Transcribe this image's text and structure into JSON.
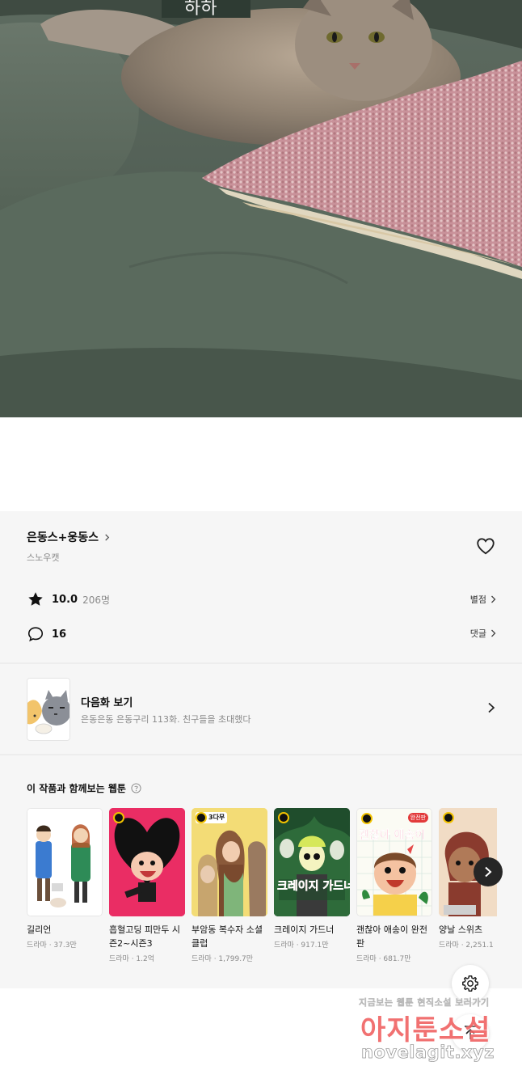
{
  "hero": {
    "overlay_text": "하하"
  },
  "work": {
    "title": "은동스+웅동스",
    "author": "스노우캣",
    "rating": "10.0",
    "rating_count": "206명",
    "rate_label": "별점",
    "comment_count": "16",
    "comment_label": "댓글"
  },
  "next_episode": {
    "title": "다음화 보기",
    "description": "은동은동 은동구리 113화. 친구들을 초대했다"
  },
  "recommendations": {
    "heading": "이 작품과 함께보는 웹툰",
    "items": [
      {
        "name": "길리언",
        "meta": "드라마 · 37.3만",
        "badge": ""
      },
      {
        "name": "흡혈고딩 피만두 시즌2~시즌3",
        "meta": "드라마 · 1.2억",
        "badge": ""
      },
      {
        "name": "부암동 복수자 소셜클럽",
        "meta": "드라마 · 1,799.7만",
        "badge": "3다무"
      },
      {
        "name": "크레이지 가드너",
        "meta": "드라마 · 917.1만",
        "badge": "",
        "cover_text": "크레이지 가드너"
      },
      {
        "name": "괜찮아 애송이 완전판",
        "meta": "드라마 · 681.7만",
        "badge": "",
        "cover_text": "괜찮아 애송이"
      },
      {
        "name": "양날 스위츠",
        "meta": "드라마 · 2,251.1",
        "badge": ""
      }
    ]
  },
  "watermark": {
    "line1": "지금보는 웹툰 현직소설 보러가기",
    "line2": "아지툰소설",
    "line3": "novelagit.xyz"
  }
}
